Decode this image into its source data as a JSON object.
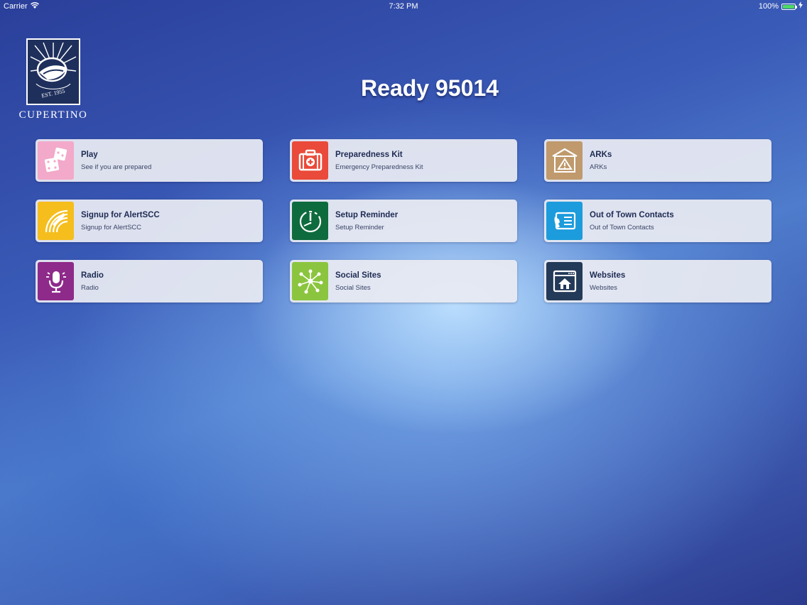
{
  "status_bar": {
    "carrier": "Carrier",
    "time": "7:32 PM",
    "battery": "100%",
    "battery_level": 1.0
  },
  "logo": {
    "est": "EST. 1955",
    "city": "CUPERTINO"
  },
  "title": "Ready 95014",
  "tiles": [
    {
      "title": "Play",
      "subtitle": "See if you are prepared",
      "icon": "dice-icon",
      "color": "#f3a9c9"
    },
    {
      "title": "Preparedness Kit",
      "subtitle": "Emergency Preparedness Kit",
      "icon": "first-aid-kit-icon",
      "color": "#ea4a3a"
    },
    {
      "title": "ARKs",
      "subtitle": "ARKs",
      "icon": "warning-shed-icon",
      "color": "#c09a6c"
    },
    {
      "title": "Signup for AlertSCC",
      "subtitle": "Signup for AlertSCC",
      "icon": "alert-pen-icon",
      "color": "#f5be1d"
    },
    {
      "title": "Setup Reminder",
      "subtitle": "Setup Reminder",
      "icon": "clock-alert-icon",
      "color": "#0e6b3d"
    },
    {
      "title": "Out of Town Contacts",
      "subtitle": "Out of Town Contacts",
      "icon": "phone-contact-icon",
      "color": "#1c9cdc"
    },
    {
      "title": "Radio",
      "subtitle": "Radio",
      "icon": "microphone-icon",
      "color": "#8e2a8a"
    },
    {
      "title": "Social Sites",
      "subtitle": "Social Sites",
      "icon": "network-icon",
      "color": "#8bc53f"
    },
    {
      "title": "Websites",
      "subtitle": "Websites",
      "icon": "browser-home-icon",
      "color": "#233a58"
    }
  ]
}
